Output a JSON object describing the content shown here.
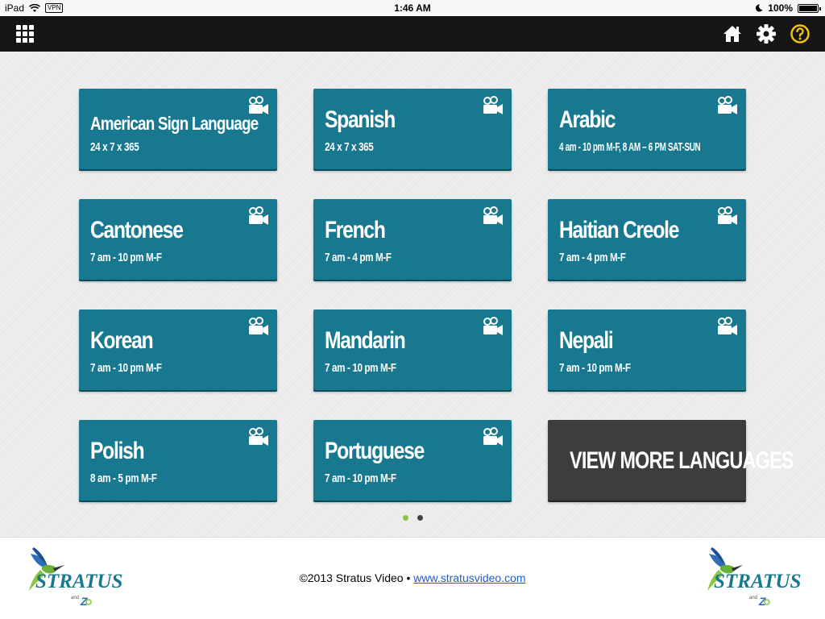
{
  "status_bar": {
    "device": "iPad",
    "vpn": "VPN",
    "time": "1:46 AM",
    "battery": "100%"
  },
  "toolbar": {
    "icons": [
      "grid-icon",
      "home-icon",
      "gear-icon",
      "help-icon"
    ]
  },
  "tiles": [
    {
      "name": "American Sign Language",
      "hours": "24 x 7 x 365"
    },
    {
      "name": "Spanish",
      "hours": "24 x 7 x 365"
    },
    {
      "name": "Arabic",
      "hours": "4 am - 10 pm M-F, 8 AM – 6 PM SAT-SUN"
    },
    {
      "name": "Cantonese",
      "hours": "7 am - 10 pm M-F"
    },
    {
      "name": "French",
      "hours": "7 am - 4 pm M-F"
    },
    {
      "name": "Haitian Creole",
      "hours": "7 am - 4 pm M-F"
    },
    {
      "name": "Korean",
      "hours": "7 am - 10 pm M-F"
    },
    {
      "name": "Mandarin",
      "hours": "7 am - 10 pm M-F"
    },
    {
      "name": "Nepali",
      "hours": "7 am - 10 pm M-F"
    },
    {
      "name": "Polish",
      "hours": "8 am - 5 pm M-F"
    },
    {
      "name": "Portuguese",
      "hours": "7 am - 10 pm M-F"
    }
  ],
  "view_more": {
    "label": "VIEW MORE LANGUAGES"
  },
  "pager": {
    "active": 0,
    "count": 2
  },
  "footer": {
    "copyright": "©2013 Stratus Video • ",
    "link": "www.stratusvideo.com",
    "logo_text": "STRATUS"
  },
  "colors": {
    "tile": "#17788f",
    "view_more": "#3d3d3d",
    "toolbar": "#151515",
    "pager_active": "#8bc34a",
    "pager_inactive": "#444444",
    "help_icon": "#f4c20d"
  }
}
